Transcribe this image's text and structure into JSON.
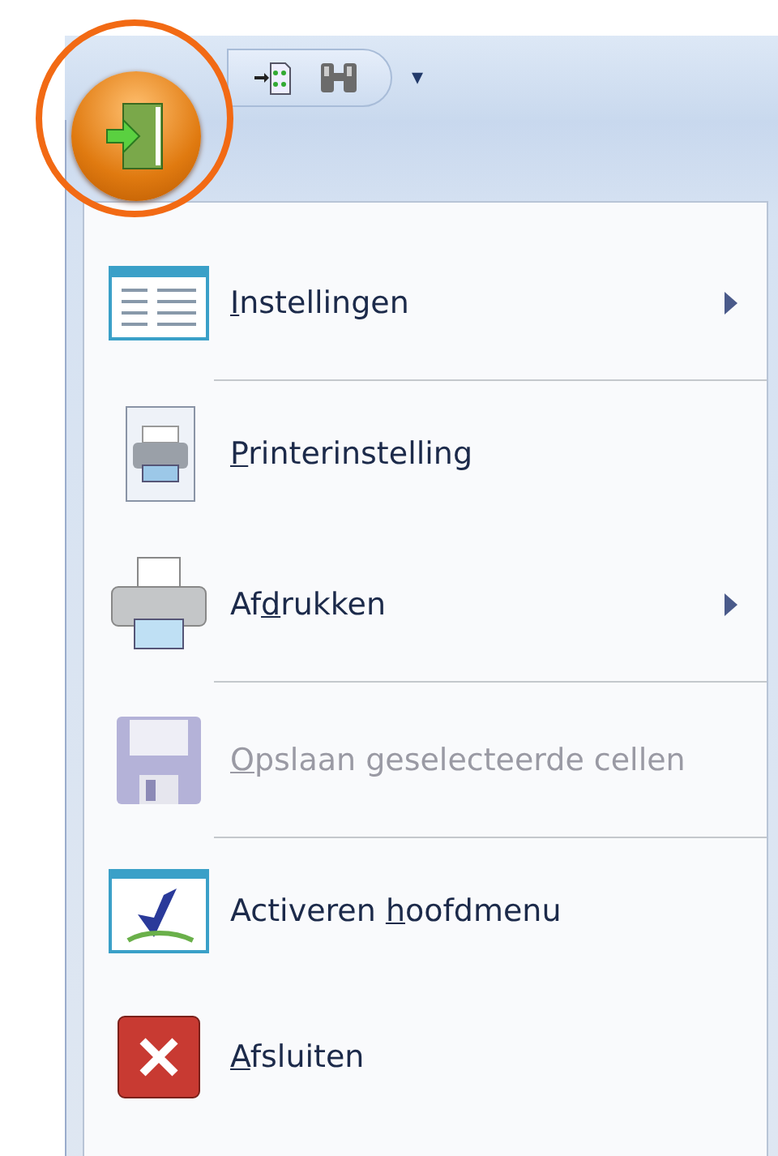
{
  "quick_access_toolbar": {
    "buttons": [
      {
        "kind": "import"
      },
      {
        "kind": "binoculars"
      }
    ],
    "customize": "▾"
  },
  "highlight": {
    "shown": true
  },
  "menu": {
    "items": [
      {
        "kind": "list",
        "access_key": "I",
        "label_after": "nstellingen",
        "submenu": true,
        "disabled": false,
        "separator_after": true
      },
      {
        "kind": "printer-setup",
        "access_key": "P",
        "label_after": "rinterinstelling",
        "submenu": false,
        "disabled": false,
        "separator_after": false
      },
      {
        "kind": "printer",
        "label_before": "Af",
        "access_key": "d",
        "label_after": "rukken",
        "submenu": true,
        "disabled": false,
        "separator_after": true
      },
      {
        "kind": "floppy",
        "access_key": "O",
        "label_after": "pslaan geselecteerde cellen",
        "submenu": false,
        "disabled": true,
        "separator_after": true
      },
      {
        "kind": "app",
        "label_before": "Activeren ",
        "access_key": "h",
        "label_after": "oofdmenu",
        "submenu": false,
        "disabled": false,
        "separator_after": false
      },
      {
        "kind": "close",
        "access_key": "A",
        "label_after": "fsluiten",
        "submenu": false,
        "disabled": false,
        "separator_after": false
      }
    ]
  }
}
